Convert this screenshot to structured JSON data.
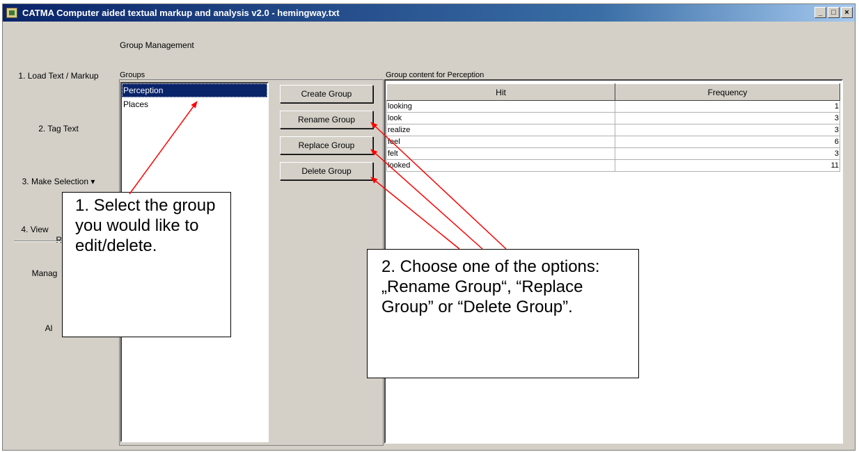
{
  "window": {
    "title": "CATMA Computer aided textual markup and analysis v2.0  - hemingway.txt",
    "controls": [
      "_",
      "□",
      "×"
    ]
  },
  "nav": {
    "items": [
      {
        "label": "1. Load Text / Markup"
      },
      {
        "label": "2. Tag Text"
      },
      {
        "label": "3. Make Selection ▾"
      },
      {
        "label": "4. View"
      },
      {
        "label": "Re"
      },
      {
        "label": "Manag"
      },
      {
        "label": "Al"
      }
    ]
  },
  "main": {
    "section_title": "Group Management",
    "groups_label": "Groups",
    "groups": [
      "Perception",
      "Places"
    ],
    "selected_group": "Perception",
    "buttons": {
      "create": "Create Group",
      "rename": "Rename Group",
      "replace": "Replace Group",
      "delete": "Delete Group"
    },
    "content_label": "Group content for Perception",
    "table": {
      "columns": [
        "Hit",
        "Frequency"
      ],
      "rows": [
        {
          "hit": "looking",
          "frequency": "1"
        },
        {
          "hit": "look",
          "frequency": "3"
        },
        {
          "hit": "realize",
          "frequency": "3"
        },
        {
          "hit": "feel",
          "frequency": "6"
        },
        {
          "hit": "felt",
          "frequency": "3"
        },
        {
          "hit": "looked",
          "frequency": "11"
        }
      ]
    }
  },
  "annotations": {
    "callout1": "1. Select the group you would like to edit/delete.",
    "callout2": "2. Choose one of the options: „Rename Group“, “Replace Group” or “Delete Group”.",
    "arrow_color": "#ff0000"
  }
}
